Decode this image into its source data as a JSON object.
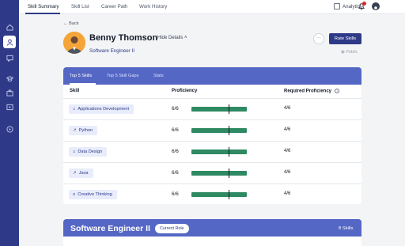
{
  "nav": {
    "tabs": [
      {
        "label": "Skill Summary"
      },
      {
        "label": "Skill List"
      },
      {
        "label": "Career Path"
      },
      {
        "label": "Work History"
      }
    ],
    "analytics_label": "Analytics",
    "notification_count": 1
  },
  "sidebar": {
    "items": [
      "home-icon",
      "person-icon",
      "chat-icon",
      "graduation-icon",
      "briefcase-icon",
      "play-icon",
      "compass-icon"
    ]
  },
  "profile": {
    "back_label": "Back",
    "name": "Benny Thomson",
    "hide_details_label": "Hide Details",
    "role": "Software Engineer II",
    "more_label": "···",
    "rate_skills_label": "Rate Skills",
    "visibility": "Public"
  },
  "skills_card": {
    "tabs": [
      "Top 5 Skills",
      "Top 5 Skill Gaps",
      "Stats"
    ],
    "columns": {
      "skill": "Skill",
      "proficiency": "Proficiency",
      "required": "Required Proficiency"
    },
    "rows": [
      {
        "icon": "⌂",
        "skill": "Applications Development",
        "proficiency": "6/6",
        "level": 1.0,
        "required": "4/6",
        "required_level": 0.667
      },
      {
        "icon": "↗",
        "skill": "Python",
        "proficiency": "6/6",
        "level": 1.0,
        "required": "4/6",
        "required_level": 0.667
      },
      {
        "icon": "⌂",
        "skill": "Data Design",
        "proficiency": "6/6",
        "level": 1.0,
        "required": "4/6",
        "required_level": 0.667
      },
      {
        "icon": "↗",
        "skill": "Java",
        "proficiency": "6/6",
        "level": 1.0,
        "required": "4/6",
        "required_level": 0.667
      },
      {
        "icon": "≡",
        "skill": "Creative Thinking",
        "proficiency": "6/6",
        "level": 1.0,
        "required": "4/6",
        "required_level": 0.667
      }
    ]
  },
  "role_card": {
    "title": "Software Engineer II",
    "badge": "Current Role",
    "skills_count": "8 Skills"
  },
  "colors": {
    "brand": "#2e3a87",
    "tab_band": "#5567c4",
    "bar_fill": "#2f8a63",
    "avatar_bg": "#f5a43a"
  }
}
